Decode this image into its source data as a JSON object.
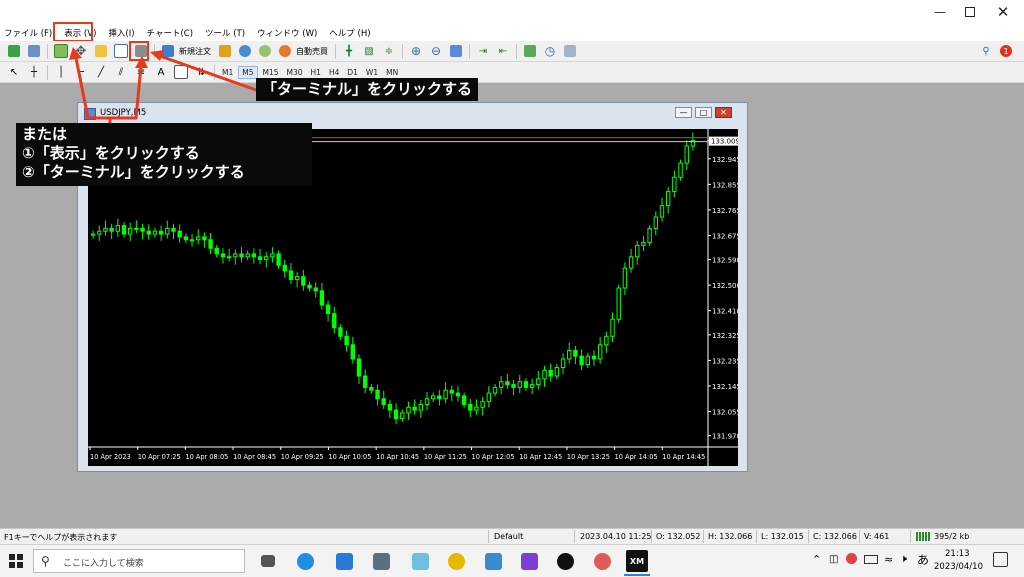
{
  "menu": [
    "ファイル (F)",
    "表示 (V)",
    "挿入(I)",
    "チャート(C)",
    "ツール (T)",
    "ウィンドウ (W)",
    "ヘルプ (H)"
  ],
  "toolbar": {
    "new_order": "新規注文",
    "auto_trading": "自動売買"
  },
  "timeframes": [
    "M1",
    "M5",
    "M15",
    "M30",
    "H1",
    "H4",
    "D1",
    "W1",
    "MN"
  ],
  "selected_timeframe": "M5",
  "text_tool": "A",
  "callout_top": "「ターミナル」をクリックする",
  "callout_left": [
    "または",
    "①「表示」をクリックする",
    "②「ターミナル」をクリックする"
  ],
  "chart_window": {
    "title": "USDJPY,M5"
  },
  "colors": {
    "highlight": "#e53a1c",
    "candle": "#00ff00",
    "bid_line": "#ff3030"
  },
  "chart_data": {
    "type": "candlestick",
    "symbol": "USDJPY",
    "timeframe": "M5",
    "y_ticks": [
      "133.009",
      "132.945",
      "132.855",
      "132.765",
      "132.675",
      "132.590",
      "132.500",
      "132.410",
      "132.325",
      "132.235",
      "132.145",
      "132.055",
      "131.970"
    ],
    "y_range": [
      131.93,
      133.05
    ],
    "x_ticks": [
      "10 Apr 2023",
      "10 Apr 07:25",
      "10 Apr 08:05",
      "10 Apr 08:45",
      "10 Apr 09:25",
      "10 Apr 10:05",
      "10 Apr 10:45",
      "10 Apr 11:25",
      "10 Apr 12:05",
      "10 Apr 12:45",
      "10 Apr 13:25",
      "10 Apr 14:05",
      "10 Apr 14:45"
    ],
    "current_price": 133.009,
    "close_path": [
      132.68,
      132.69,
      132.7,
      132.69,
      132.71,
      132.68,
      132.7,
      132.7,
      132.69,
      132.68,
      132.69,
      132.68,
      132.7,
      132.69,
      132.67,
      132.66,
      132.66,
      132.67,
      132.66,
      132.63,
      132.61,
      132.6,
      132.6,
      132.61,
      132.6,
      132.61,
      132.6,
      132.59,
      132.6,
      132.61,
      132.57,
      132.55,
      132.52,
      132.53,
      132.5,
      132.49,
      132.48,
      132.43,
      132.4,
      132.35,
      132.32,
      132.29,
      132.24,
      132.18,
      132.14,
      132.13,
      132.1,
      132.08,
      132.06,
      132.03,
      132.05,
      132.07,
      132.06,
      132.08,
      132.1,
      132.11,
      132.1,
      132.13,
      132.12,
      132.11,
      132.08,
      132.06,
      132.07,
      132.09,
      132.12,
      132.14,
      132.16,
      132.15,
      132.14,
      132.16,
      132.14,
      132.15,
      132.17,
      132.2,
      132.18,
      132.21,
      132.24,
      132.27,
      132.25,
      132.22,
      132.25,
      132.24,
      132.29,
      132.32,
      132.38,
      132.49,
      132.56,
      132.6,
      132.64,
      132.65,
      132.7,
      132.74,
      132.78,
      132.83,
      132.88,
      132.93,
      132.99,
      133.01
    ]
  },
  "status": {
    "help": "F1キーでヘルプが表示されます",
    "profile": "Default",
    "time": "2023.04.10 11:25",
    "open": "O: 132.052",
    "high": "H: 132.066",
    "low": "L: 132.015",
    "close": "C: 132.066",
    "volume": "V: 461",
    "traffic": "395/2 kb"
  },
  "taskbar": {
    "search_placeholder": "ここに入力して検索",
    "clock_time": "21:13",
    "clock_date": "2023/04/10",
    "ime": "あ",
    "notification_count": "1",
    "xm_label": "XM"
  }
}
